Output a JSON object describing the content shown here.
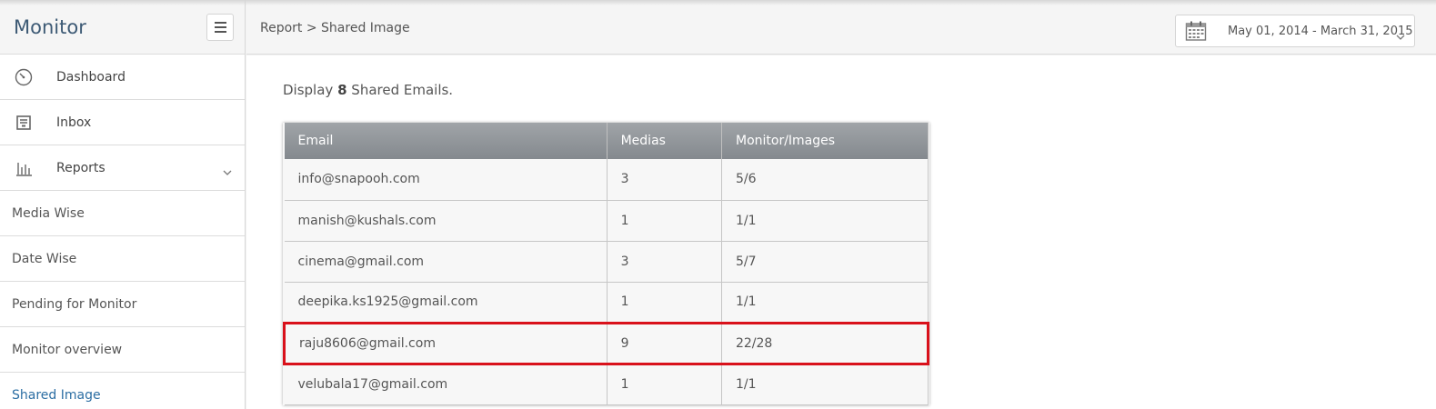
{
  "sidebar": {
    "title": "Monitor",
    "nav": [
      {
        "label": "Dashboard",
        "icon": "gauge-icon"
      },
      {
        "label": "Inbox",
        "icon": "inbox-icon"
      },
      {
        "label": "Reports",
        "icon": "bar-chart-icon"
      }
    ],
    "sub_items": [
      {
        "label": "Media Wise"
      },
      {
        "label": "Date Wise"
      },
      {
        "label": "Pending for Monitor"
      },
      {
        "label": "Monitor overview"
      },
      {
        "label": "Shared Image",
        "active": true
      }
    ]
  },
  "header": {
    "breadcrumb": "Report > Shared Image",
    "date_range": "May 01, 2014 - March 31, 2015"
  },
  "main": {
    "summary_prefix": "Display",
    "summary_count": "8",
    "summary_suffix": "Shared Emails.",
    "table": {
      "columns": [
        "Email",
        "Medias",
        "Monitor/Images"
      ],
      "rows": [
        [
          "info@snapooh.com",
          "3",
          "5/6"
        ],
        [
          "manish@kushals.com",
          "1",
          "1/1"
        ],
        [
          "cinema@gmail.com",
          "3",
          "5/7"
        ],
        [
          "deepika.ks1925@gmail.com",
          "1",
          "1/1"
        ],
        [
          "raju8606@gmail.com",
          "9",
          "22/28"
        ],
        [
          "velubala17@gmail.com",
          "1",
          "1/1"
        ]
      ]
    }
  },
  "colors": {
    "brand": "#3d5a75",
    "active_link": "#2c6ea3",
    "highlight": "#d9111b"
  }
}
